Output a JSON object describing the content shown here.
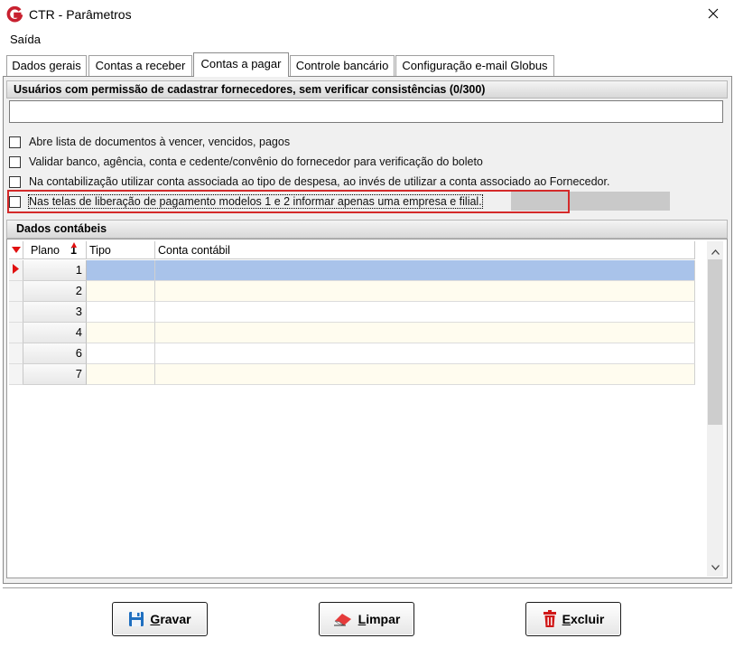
{
  "window": {
    "title": "CTR - Parâmetros"
  },
  "menu": {
    "items": [
      {
        "label": "Saída"
      }
    ]
  },
  "tabs": [
    {
      "label": "Dados gerais",
      "active": false
    },
    {
      "label": "Contas a receber",
      "active": false
    },
    {
      "label": "Contas a pagar",
      "active": true
    },
    {
      "label": "Controle bancário",
      "active": false
    },
    {
      "label": "Configuração e-mail Globus",
      "active": false
    }
  ],
  "permissions": {
    "header": "Usuários com permissão de cadastrar fornecedores, sem verificar consistências (0/300)",
    "value": ""
  },
  "options": [
    {
      "label": "Abre lista de documentos à vencer, vencidos, pagos",
      "checked": false
    },
    {
      "label": "Validar banco, agência, conta e cedente/convênio do fornecedor para verificação do boleto",
      "checked": false
    },
    {
      "label": "Na contabilização utilizar conta associada ao tipo de despesa, ao  invés de utilizar a conta associado ao Fornecedor.",
      "checked": false
    },
    {
      "label": "Nas telas de liberação de pagamento modelos 1 e 2 informar apenas uma empresa e filial.",
      "checked": false,
      "highlighted": true
    }
  ],
  "dados_contabeis": {
    "header": "Dados contábeis",
    "columns": [
      {
        "label": "Plano",
        "sort_indicator": "1"
      },
      {
        "label": "Tipo"
      },
      {
        "label": "Conta contábil"
      }
    ],
    "rows": [
      {
        "plano": "1",
        "tipo": "",
        "conta": "",
        "selected": true
      },
      {
        "plano": "2",
        "tipo": "",
        "conta": ""
      },
      {
        "plano": "3",
        "tipo": "",
        "conta": ""
      },
      {
        "plano": "4",
        "tipo": "",
        "conta": ""
      },
      {
        "plano": "6",
        "tipo": "",
        "conta": ""
      },
      {
        "plano": "7",
        "tipo": "",
        "conta": ""
      }
    ]
  },
  "buttons": {
    "gravar": {
      "accel": "G",
      "rest": "ravar",
      "icon": "floppy-disk-icon"
    },
    "limpar": {
      "accel": "L",
      "rest": "impar",
      "icon": "eraser-icon"
    },
    "excluir": {
      "accel": "E",
      "rest": "xcluir",
      "icon": "trash-icon"
    }
  },
  "colors": {
    "highlight_border": "#d42a2a",
    "selected_row": "#a9c3ea",
    "cream_row": "#fffcef",
    "app_icon": "#c8202f"
  }
}
